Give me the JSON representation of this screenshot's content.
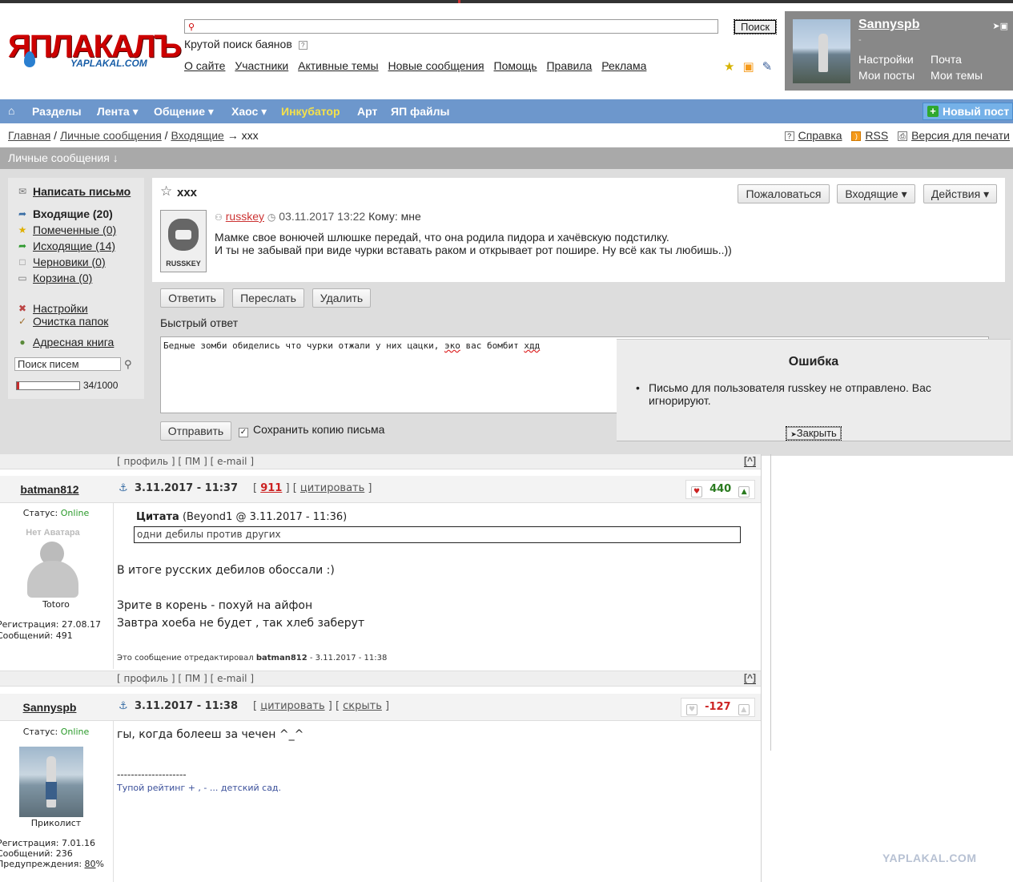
{
  "logo": {
    "main": "ЯПЛАКАЛЪ",
    "sub": "YAPLAKAL.COM"
  },
  "header": {
    "search_button": "Поиск",
    "bayan_link": "Крутой поиск баянов",
    "bayan_help": "?",
    "nav": [
      "О сайте",
      "Участники",
      "Активные темы",
      "Новые сообщения",
      "Помощь",
      "Правила",
      "Реклама"
    ],
    "icons": [
      "star-icon",
      "rss-icon",
      "pin-icon"
    ]
  },
  "user": {
    "name": "Sannyspb",
    "dash": "-",
    "links": {
      "settings": "Настройки",
      "mail": "Почта",
      "posts": "Мои посты",
      "topics": "Мои темы"
    }
  },
  "mainnav": {
    "home_icon": "⌂",
    "items": [
      "Разделы",
      "Лента ▾",
      "Общение ▾",
      "Хаос ▾",
      "Инкубатор",
      "Арт",
      "ЯП файлы"
    ],
    "new_post": "Новый пост"
  },
  "breadcrumb": {
    "home": "Главная",
    "pm": "Личные сообщения",
    "inbox": "Входящие",
    "current": "→ xxx"
  },
  "tools": {
    "help": "Справка",
    "rss": "RSS",
    "print": "Версия для печати"
  },
  "pm": {
    "bar_title": "Личные сообщения ↓",
    "sidebar": {
      "compose": "Написать письмо",
      "inbox": "Входящие (20)",
      "marked": "Помеченные (0)",
      "outbox": "Исходящие (14)",
      "drafts": "Черновики (0)",
      "trash": "Корзина (0)",
      "settings": "Настройки",
      "clean": "Очистка папок",
      "addressbook": "Адресная книга",
      "search_placeholder": "Поиск писем",
      "quota_text": "34/1000",
      "quota_fraction": 0.034
    },
    "message": {
      "title": "xxx",
      "buttons": {
        "report": "Пожаловаться",
        "folder": "Входящие ▾",
        "actions": "Действия ▾"
      },
      "avatar_tag": "RUSSKEY",
      "from": "russkey",
      "date": "03.11.2017 13:22",
      "to": "Кому: мне",
      "line1": "Мамке свое вонючей шлюшке передай, что она родила пидора и хачёвскую подстилку.",
      "line2": "И ты не забывай при виде чурки вставать раком и открывает рот пошире. Ну всё как ты любишь..))"
    },
    "actions": {
      "reply": "Ответить",
      "forward": "Переслать",
      "delete": "Удалить"
    },
    "quick_reply": {
      "label": "Быстрый ответ",
      "text_a": "Бедные зомби обиделись что чурки отжали у них цацки, ",
      "text_b": "эко",
      "text_c": " вас бомбит ",
      "text_d": "хдд",
      "send": "Отправить",
      "save_copy": "Сохранить копию письма"
    },
    "error": {
      "title": "Ошибка",
      "message": "Письмо для пользователя russkey не отправлено. Вас игнорируют.",
      "close": "Закрыть"
    }
  },
  "posts": {
    "links": "[ профиль ] [ ПМ ] [ e-mail ]",
    "up": "[^]",
    "p1": {
      "nick": "batman812",
      "datetime": "3.11.2017 - 11:37",
      "count": "911",
      "cite": "цитировать",
      "rating": "440",
      "status_label": "Статус:",
      "status": "Online",
      "avatar_label": "Нет Аватара",
      "title": "Totoro",
      "reg": "Регистрация: 27.08.17",
      "msgs": "Сообщений: 491",
      "quote_author": "Цитата",
      "quote_meta": "(Beyond1 @ 3.11.2017 - 11:36)",
      "quote_text": "одни дебилы против других",
      "line1": "В итоге русских дебилов обоссали :)",
      "line2": "Зрите в корень - похуй на айфон",
      "line3": "Завтра хоеба не будет , так хлеб заберут",
      "edited_a": "Это сообщение отредактировал ",
      "edited_b": "batman812",
      "edited_c": " - 3.11.2017 - 11:38"
    },
    "p2": {
      "nick": "Sannyspb",
      "datetime": "3.11.2017 - 11:38",
      "cite": "цитировать",
      "hide": "скрыть",
      "rating": "-127",
      "status_label": "Статус:",
      "status": "Online",
      "title": "Приколист",
      "reg": "Регистрация: 7.01.16",
      "msgs": "Сообщений: 236",
      "warn": "Предупреждения:",
      "warn_val": "80",
      "warn_pct": "%",
      "text": "гы, когда болееш за чечен ^_^",
      "sig_line": "--------------------",
      "sig": "Тупой рейтинг + , - ... детский сад."
    }
  },
  "watermark": "YAPLAKAL.COM",
  "colors": {
    "nav_blue": "#6d97cc",
    "incubator_yellow": "#f5e14a",
    "brand_red": "#cc0000",
    "positive": "#2a7a1f",
    "negative": "#cc2222"
  }
}
